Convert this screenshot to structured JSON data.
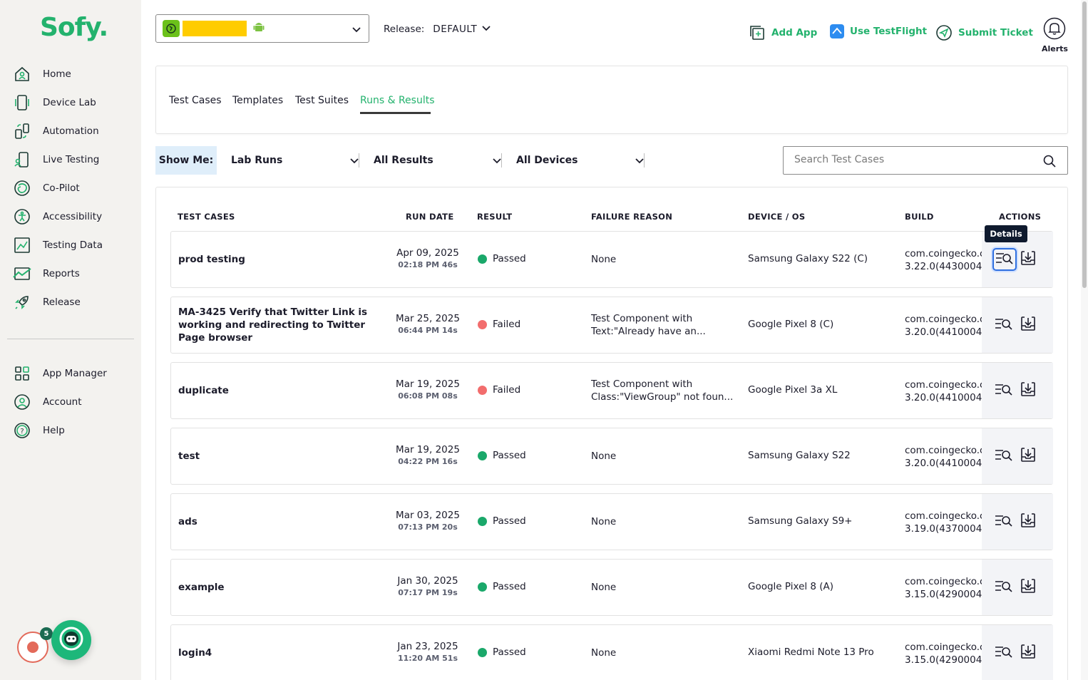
{
  "brand": {
    "logo": "Sofy."
  },
  "sidebar": {
    "main_items": [
      {
        "label": "Home",
        "icon": "home-icon"
      },
      {
        "label": "Device Lab",
        "icon": "device-icon"
      },
      {
        "label": "Automation",
        "icon": "automation-icon"
      },
      {
        "label": "Live Testing",
        "icon": "live-testing-icon"
      },
      {
        "label": "Co-Pilot",
        "icon": "copilot-icon"
      },
      {
        "label": "Accessibility",
        "icon": "accessibility-icon"
      },
      {
        "label": "Testing Data",
        "icon": "testing-data-icon"
      },
      {
        "label": "Reports",
        "icon": "reports-icon"
      },
      {
        "label": "Release",
        "icon": "rocket-icon"
      }
    ],
    "secondary_items": [
      {
        "label": "App Manager",
        "icon": "grid-icon"
      },
      {
        "label": "Account",
        "icon": "user-icon"
      },
      {
        "label": "Help",
        "icon": "help-icon"
      }
    ],
    "badge_count": "5"
  },
  "header": {
    "release_label": "Release:",
    "release_value": "DEFAULT",
    "add_app": "Add App",
    "testflight": "Use TestFlight",
    "submit_ticket": "Submit Ticket",
    "alerts": "Alerts"
  },
  "tabs": [
    {
      "label": "Test Cases"
    },
    {
      "label": "Templates"
    },
    {
      "label": "Test Suites"
    },
    {
      "label": "Runs & Results"
    }
  ],
  "filters": {
    "show_me": "Show Me:",
    "run_type": "Lab Runs",
    "results": "All Results",
    "devices": "All Devices"
  },
  "search": {
    "placeholder": "Search Test Cases"
  },
  "table": {
    "headers": {
      "test_cases": "TEST CASES",
      "run_date": "RUN DATE",
      "result": "RESULT",
      "failure_reason": "FAILURE REASON",
      "device_os": "DEVICE / OS",
      "build": "BUILD",
      "actions": "ACTIONS"
    },
    "tooltip": "Details",
    "rows": [
      {
        "name": "prod testing",
        "date": "Apr 09, 2025",
        "time": "02:18 PM 46s",
        "result": "Passed",
        "failure": "None",
        "device": "Samsung Galaxy S22 (C)",
        "build1": "com.coingecko.c",
        "build2": "3.22.0(4430004)"
      },
      {
        "name": "MA-3425 Verify that Twitter Link is working and redirecting to Twitter Page browser",
        "date": "Mar 25, 2025",
        "time": "06:44 PM 14s",
        "result": "Failed",
        "failure": "Test Component with Text:\"Already have an...",
        "device": "Google Pixel 8 (C)",
        "build1": "com.coingecko.c",
        "build2": "3.20.0(4410004)"
      },
      {
        "name": "duplicate",
        "date": "Mar 19, 2025",
        "time": "06:08 PM 08s",
        "result": "Failed",
        "failure": "Test Component with Class:\"ViewGroup\" not foun...",
        "device": "Google Pixel 3a XL",
        "build1": "com.coingecko.c",
        "build2": "3.20.0(4410004)"
      },
      {
        "name": "test",
        "date": "Mar 19, 2025",
        "time": "04:22 PM 16s",
        "result": "Passed",
        "failure": "None",
        "device": "Samsung Galaxy S22",
        "build1": "com.coingecko.c",
        "build2": "3.20.0(4410004)"
      },
      {
        "name": "ads",
        "date": "Mar 03, 2025",
        "time": "07:13 PM 20s",
        "result": "Passed",
        "failure": "None",
        "device": "Samsung Galaxy S9+",
        "build1": "com.coingecko.c",
        "build2": "3.19.0(4370004)"
      },
      {
        "name": "example",
        "date": "Jan 30, 2025",
        "time": "07:17 PM 19s",
        "result": "Passed",
        "failure": "None",
        "device": "Google Pixel 8 (A)",
        "build1": "com.coingecko.c",
        "build2": "3.15.0(4290004)"
      },
      {
        "name": "login4",
        "date": "Jan 23, 2025",
        "time": "11:20 AM 51s",
        "result": "Passed",
        "failure": "None",
        "device": "Xiaomi Redmi Note 13 Pro",
        "build1": "com.coingecko.c",
        "build2": "3.15.0(4290004)"
      }
    ]
  },
  "colors": {
    "brand": "#23b26d",
    "passed": "#1aa86a",
    "failed": "#f26d6d",
    "focus": "#2f6fe0"
  }
}
